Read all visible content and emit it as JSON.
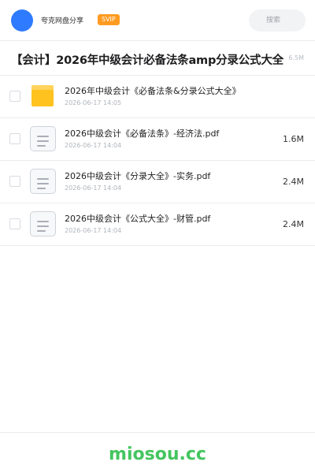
{
  "header": {
    "username": "夸克网盘分享",
    "vip_badge": "SVIP",
    "search_placeholder": "搜索"
  },
  "share": {
    "title": "【会计】2026年中级会计必备法条amp分录公式大全",
    "total_size": "6.5M"
  },
  "files": [
    {
      "name": "2026年中级会计《必备法条&分录公式大全》",
      "date": "2026-06-17 14:05",
      "size": "",
      "type": "folder"
    },
    {
      "name": "2026中级会计《必备法条》-经济法.pdf",
      "date": "2026-06-17 14:04",
      "size": "1.6M",
      "type": "file"
    },
    {
      "name": "2026中级会计《分录大全》-实务.pdf",
      "date": "2026-06-17 14:04",
      "size": "2.4M",
      "type": "file"
    },
    {
      "name": "2026中级会计《公式大全》-财管.pdf",
      "date": "2026-06-17 14:04",
      "size": "2.4M",
      "type": "file"
    }
  ],
  "footer": {
    "brand": "miosou.cc"
  },
  "colors": {
    "accent": "#2f7bff",
    "vip": "#ff9b21",
    "folder": "#ffc21e",
    "brand": "#44c55f"
  }
}
